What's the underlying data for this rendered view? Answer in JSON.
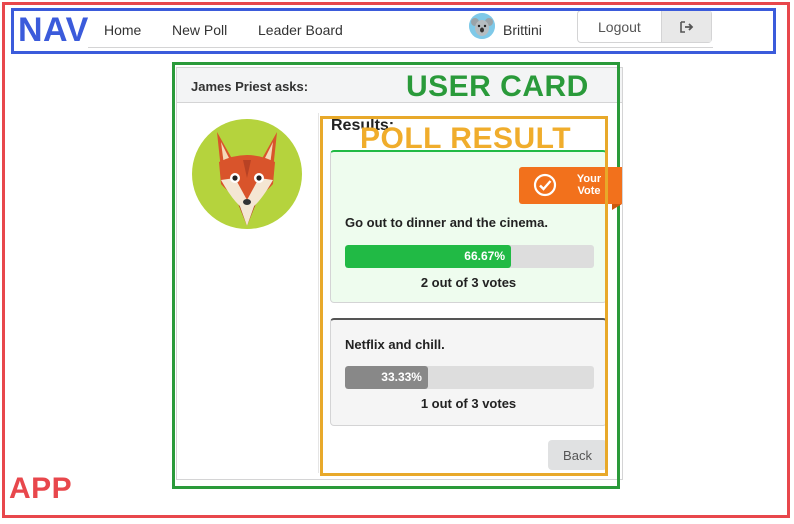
{
  "annotations": {
    "app": "APP",
    "nav": "NAV",
    "user_card": "USER CARD",
    "poll_result": "POLL RESULT"
  },
  "nav": {
    "items": [
      {
        "label": "Home"
      },
      {
        "label": "New Poll"
      },
      {
        "label": "Leader Board"
      }
    ],
    "user_name": "Brittini",
    "logout_label": "Logout",
    "avatar_icon": "koala-avatar-icon",
    "logout_icon": "sign-out-icon"
  },
  "card": {
    "header": "James Priest asks:",
    "avatar_icon": "fox-avatar-icon",
    "results_title": "Results:",
    "your_vote_label": "Your Vote",
    "options": [
      {
        "text": "Go out to dinner and the cinema.",
        "percent": "66.67%",
        "percent_value": 66.67,
        "votes": "2 out of 3 votes",
        "voted": true
      },
      {
        "text": "Netflix and chill.",
        "percent": "33.33%",
        "percent_value": 33.33,
        "votes": "1 out of 3 votes",
        "voted": false
      }
    ],
    "back_label": "Back"
  },
  "colors": {
    "app_annotation": "#e8474c",
    "nav_annotation": "#3b5bdb",
    "user_card_annotation": "#2a9a3a",
    "poll_annotation": "#e8a92a",
    "voted_bar": "#21ba45",
    "other_bar": "#888888",
    "ribbon": "#f2711c"
  }
}
